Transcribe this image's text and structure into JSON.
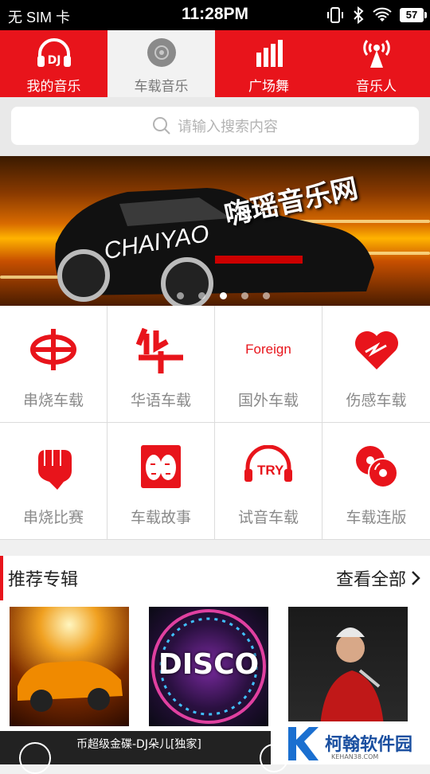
{
  "status_bar": {
    "carrier": "无 SIM 卡",
    "time": "11:28PM",
    "battery": "57"
  },
  "tabs": [
    {
      "label": "我的音乐",
      "icon": "dj-headphones-icon",
      "active": false
    },
    {
      "label": "车载音乐",
      "icon": "disc-icon",
      "active": true
    },
    {
      "label": "广场舞",
      "icon": "bar-chart-icon",
      "active": false
    },
    {
      "label": "音乐人",
      "icon": "broadcast-tower-icon",
      "active": false
    }
  ],
  "search": {
    "placeholder": "请输入搜索内容"
  },
  "banner": {
    "brand_text": "嗨瑶音乐网",
    "logo_text": "CHAIYAO",
    "page_count": 5,
    "current_page": 3
  },
  "categories": [
    {
      "label": "串烧车载",
      "icon": "medley-icon"
    },
    {
      "label": "华语车载",
      "icon": "chinese-char-icon"
    },
    {
      "label": "国外车载",
      "icon": "foreign-icon",
      "icon_text": "Foreign"
    },
    {
      "label": "伤感车载",
      "icon": "broken-heart-icon"
    },
    {
      "label": "串烧比赛",
      "icon": "fist-icon"
    },
    {
      "label": "车载故事",
      "icon": "faces-icon"
    },
    {
      "label": "试音车载",
      "icon": "try-headphones-icon",
      "icon_text": "TRY"
    },
    {
      "label": "车载连版",
      "icon": "discs-icon"
    }
  ],
  "recommend": {
    "title": "推荐专辑",
    "more": "查看全部"
  },
  "albums": [
    {
      "name": "car-album"
    },
    {
      "name": "disco-album",
      "text": "DISCO"
    },
    {
      "name": "singer-album"
    }
  ],
  "player": {
    "now_playing": "币超级金碟-DJ朵儿[独家]"
  },
  "watermark": {
    "text": "柯翰软件园",
    "sub": "KEHAN38.COM"
  },
  "colors": {
    "accent": "#e8141b"
  }
}
